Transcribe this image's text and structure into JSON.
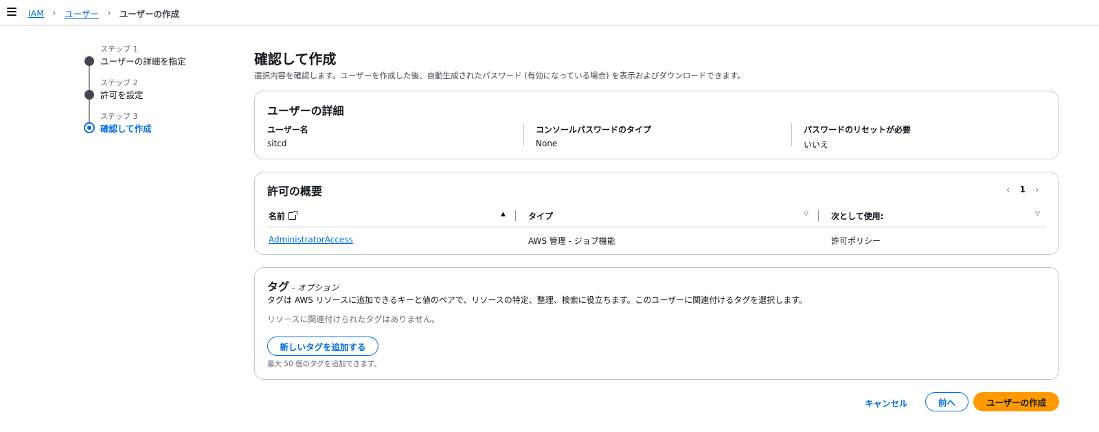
{
  "breadcrumb": {
    "items": [
      "IAM",
      "ユーザー"
    ],
    "current": "ユーザーの作成"
  },
  "steps": [
    {
      "num": "ステップ 1",
      "title": "ユーザーの詳細を指定",
      "state": "complete"
    },
    {
      "num": "ステップ 2",
      "title": "許可を設定",
      "state": "complete"
    },
    {
      "num": "ステップ 3",
      "title": "確認して作成",
      "state": "active"
    }
  ],
  "page": {
    "title": "確認して作成",
    "description": "選択内容を確認します。ユーザーを作成した後、自動生成されたパスワード (有効になっている場合) を表示およびダウンロードできます。"
  },
  "user_details": {
    "title": "ユーザーの詳細",
    "fields": [
      {
        "label": "ユーザー名",
        "value": "sitcd"
      },
      {
        "label": "コンソールパスワードのタイプ",
        "value": "None"
      },
      {
        "label": "パスワードのリセットが必要",
        "value": "いいえ"
      }
    ]
  },
  "permissions": {
    "title": "許可の概要",
    "page": "1",
    "columns": [
      "名前",
      "タイプ",
      "次として使用:"
    ],
    "rows": [
      {
        "name": "AdministratorAccess",
        "type": "AWS 管理 - ジョブ機能",
        "used_as": "許可ポリシー"
      }
    ]
  },
  "tags": {
    "title": "タグ",
    "optional": "- オプション",
    "description": "タグは AWS リソースに追加できるキーと値のペアで、リソースの特定、整理、検索に役立ちます。このユーザーに関連付けるタグを選択します。",
    "empty": "リソースに関連付けられたタグはありません。",
    "add_button": "新しいタグを追加する",
    "limit": "最大 50 個のタグを追加できます。"
  },
  "footer": {
    "cancel": "キャンセル",
    "previous": "前へ",
    "create": "ユーザーの作成"
  },
  "colors": {
    "link": "#006ce0",
    "primary": "#ff9900",
    "border": "#c6c6cd"
  }
}
